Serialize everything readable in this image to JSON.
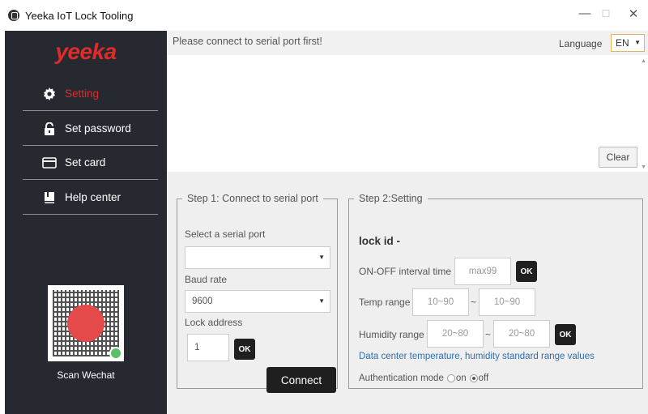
{
  "window": {
    "title": "Yeeka IoT Lock Tooling",
    "minimize": "—",
    "maximize": "☐",
    "close": "✕"
  },
  "sidebar": {
    "logo": "yeeka",
    "items": [
      {
        "label": "Setting",
        "icon": "gear-icon"
      },
      {
        "label": "Set password",
        "icon": "lock-icon"
      },
      {
        "label": "Set card",
        "icon": "card-icon"
      },
      {
        "label": "Help center",
        "icon": "book-icon"
      }
    ],
    "qr_label": "Scan Wechat"
  },
  "topbar": {
    "message": "Please connect to serial port first!",
    "language_label": "Language",
    "language_value": "EN"
  },
  "log": {
    "clear_label": "Clear"
  },
  "step1": {
    "legend": "Step 1: Connect to serial port",
    "serial_port_label": "Select a serial port",
    "serial_port_value": "",
    "baud_rate_label": "Baud rate",
    "baud_rate_value": "9600",
    "lock_address_label": "Lock address",
    "lock_address_value": "1",
    "ok_label": "OK",
    "connect_label": "Connect"
  },
  "step2": {
    "legend": "Step 2:Setting",
    "lock_id": "lock id -",
    "onoff_label": "ON-OFF interval time",
    "onoff_placeholder": "max99",
    "temp_label": "Temp range",
    "temp_min_placeholder": "10~90",
    "temp_max_placeholder": "10~90",
    "humidity_label": "Humidity range",
    "humidity_min_placeholder": "20~80",
    "humidity_max_placeholder": "20~80",
    "tilde": "~",
    "ok_label": "OK",
    "hint": "Data center temperature, humidity standard range values",
    "auth_label": "Authentication mode",
    "auth_on": "on",
    "auth_off": "off",
    "auth_selected": "off"
  },
  "colors": {
    "sidebar_bg": "#262a30",
    "brand_red": "#e02b2b",
    "hint_blue": "#2f6fb0",
    "button_dark": "#1f1f1f"
  }
}
